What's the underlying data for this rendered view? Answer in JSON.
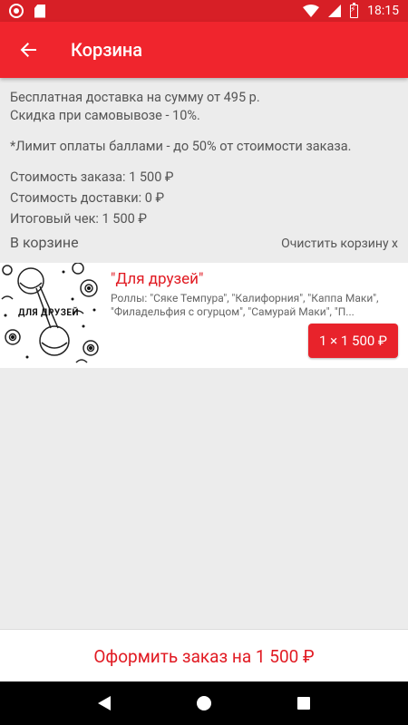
{
  "status_bar": {
    "time": "18:15"
  },
  "app_bar": {
    "title": "Корзина"
  },
  "info": {
    "delivery_line": "Бесплатная доставка на сумму от 495 р.",
    "discount_line": "Скидка при самовывозе - 10%.",
    "limit_line": "*Лимит оплаты баллами - до 50% от стоимости заказа.",
    "order_cost": "Стоимость заказа: 1 500 ₽",
    "delivery_cost": "Стоимость доставки: 0 ₽",
    "total": "Итоговый чек: 1 500 ₽"
  },
  "cart": {
    "label": "В корзине",
    "clear_label": "Очистить корзину х",
    "items": [
      {
        "image_caption": "ДЛЯ ДРУЗЕЙ",
        "name": "\"Для друзей\"",
        "description": "Роллы: \"Сяке Темпура\", \"Калифорния\", \"Каппа Маки\", \"Филадельфия с огурцом\", \"Самурай Маки\", \"П...",
        "qty_price": "1 × 1 500 ₽"
      }
    ]
  },
  "checkout": {
    "label": "Оформить заказ на 1 500 ₽"
  },
  "colors": {
    "accent": "#f0252d",
    "status_bar": "#d71f26",
    "text_red": "#e11a22"
  }
}
